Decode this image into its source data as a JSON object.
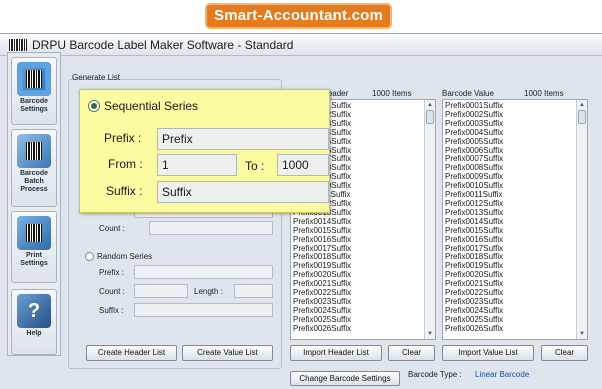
{
  "brand": "Smart-Accountant.com",
  "window": {
    "title": "DRPU Barcode Label Maker Software - Standard"
  },
  "sidebar": {
    "items": [
      {
        "label": "Barcode Settings",
        "icon": "barcode-settings-icon"
      },
      {
        "label": "Barcode Batch Process",
        "icon": "batch-process-icon"
      },
      {
        "label": "Print Settings",
        "icon": "print-settings-icon"
      },
      {
        "label": "Help",
        "icon": "help-icon"
      }
    ]
  },
  "generate_list": {
    "label": "Generate List",
    "count_label": "Count :",
    "random": {
      "label": "Random Series",
      "prefix_label": "Prefix :",
      "count_label": "Count :",
      "length_label": "Length :",
      "suffix_label": "Suffix :"
    },
    "create_header_button": "Create Header List",
    "create_value_button": "Create Value List"
  },
  "callout": {
    "title": "Sequential Series",
    "prefix_label": "Prefix :",
    "prefix_value": "Prefix",
    "from_label": "From :",
    "from_value": "1",
    "to_label": "To :",
    "to_value": "1000",
    "suffix_label": "Suffix :",
    "suffix_value": "Suffix"
  },
  "header_list": {
    "title": "Barcode Header",
    "count": "1000 Items",
    "items": [
      "Prefix0001Suffix",
      "Prefix0002Suffix",
      "Prefix0003Suffix",
      "Prefix0004Suffix",
      "Prefix0005Suffix",
      "Prefix0006Suffix",
      "Prefix0007Suffix",
      "Prefix0008Suffix",
      "Prefix0009Suffix",
      "Prefix0010Suffix",
      "Prefix0011Suffix",
      "Prefix0012Suffix",
      "Prefix0013Suffix",
      "Prefix0014Suffix",
      "Prefix0015Suffix",
      "Prefix0016Suffix",
      "Prefix0017Suffix",
      "Prefix0018Suffix",
      "Prefix0019Suffix",
      "Prefix0020Suffix",
      "Prefix0021Suffix",
      "Prefix0022Suffix",
      "Prefix0023Suffix",
      "Prefix0024Suffix",
      "Prefix0025Suffix",
      "Prefix0026Suffix"
    ],
    "import_button": "Import Header List",
    "clear_button": "Clear"
  },
  "value_list": {
    "title": "Barcode Value",
    "count": "1000 Items",
    "items": [
      "Prefix0001Suffix",
      "Prefix0002Suffix",
      "Prefix0003Suffix",
      "Prefix0004Suffix",
      "Prefix0005Suffix",
      "Prefix0006Suffix",
      "Prefix0007Suffix",
      "Prefix0008Suffix",
      "Prefix0009Suffix",
      "Prefix0010Suffix",
      "Prefix0011Suffix",
      "Prefix0012Suffix",
      "Prefix0013Suffix",
      "Prefix0014Suffix",
      "Prefix0015Suffix",
      "Prefix0016Suffix",
      "Prefix0017Suffix",
      "Prefix0018Suffix",
      "Prefix0019Suffix",
      "Prefix0020Suffix",
      "Prefix0021Suffix",
      "Prefix0022Suffix",
      "Prefix0023Suffix",
      "Prefix0024Suffix",
      "Prefix0025Suffix",
      "Prefix0026Suffix"
    ],
    "import_button": "Import Value List",
    "clear_button": "Clear"
  },
  "footer": {
    "change_settings_button": "Change Barcode Settings",
    "type_label": "Barcode Type :",
    "type_value": "Linear Barcode"
  }
}
